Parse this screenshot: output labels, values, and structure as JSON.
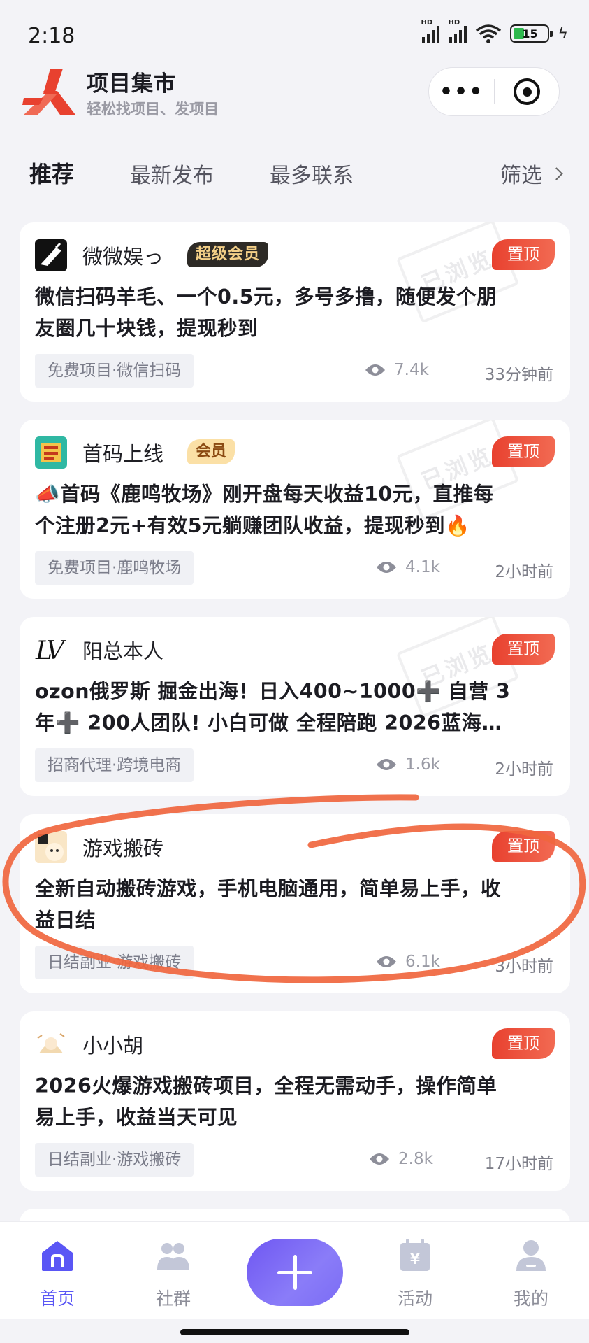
{
  "status_bar": {
    "time": "2:18",
    "signal_label_1": "HD",
    "signal_label_2": "HD",
    "battery": "15"
  },
  "header": {
    "app_title": "项目集市",
    "app_subtitle": "轻松找项目、发项目",
    "more_icon": "more-dots-icon",
    "target_icon": "target-icon",
    "brand_color": "#e8412f"
  },
  "tabs": {
    "items": [
      "推荐",
      "最新发布",
      "最多联系"
    ],
    "active": "推荐",
    "filter_label": "筛选"
  },
  "posts": [
    {
      "user": "微微娱っ",
      "badge": "超级会员",
      "pinned": "置顶",
      "title_lines": [
        "微信扫码羊毛、一个0.5元，多号多撸，随便发个朋",
        "友圈几十块钱，提现秒到"
      ],
      "tag": "免费项目·微信扫码",
      "views": "7.4k",
      "time": "33分钟前",
      "stamp": "已浏览"
    },
    {
      "user": "首码上线",
      "badge": "会员",
      "pinned": "置顶",
      "title_lines": [
        "📣首码《鹿鸣牧场》刚开盘每天收益10元，直推每",
        "个注册2元+有效5元躺赚团队收益，提现秒到🔥"
      ],
      "tag": "免费项目·鹿鸣牧场",
      "views": "4.1k",
      "time": "2小时前",
      "stamp": "已浏览"
    },
    {
      "user": "阳总本人",
      "badge": "",
      "pinned": "置顶",
      "title_lines": [
        "ozon俄罗斯 掘金出海！日入400~1000➕ 自营 3",
        "年➕ 200人团队! 小白可做 全程陪跑 2026蓝海…"
      ],
      "tag": "招商代理·跨境电商",
      "views": "1.6k",
      "time": "2小时前",
      "stamp": "已浏览"
    },
    {
      "user": "游戏搬砖",
      "badge": "",
      "pinned": "置顶",
      "title_lines": [
        "全新自动搬砖游戏，手机电脑通用，简单易上手，收",
        "益日结"
      ],
      "tag": "日结副业·游戏搬砖",
      "views": "6.1k",
      "time": "3小时前",
      "stamp": ""
    },
    {
      "user": "小小胡",
      "badge": "",
      "pinned": "置顶",
      "title_lines": [
        "2026火爆游戏搬砖项目，全程无需动手，操作简单",
        "易上手，收益当天可见"
      ],
      "tag": "日结副业·游戏搬砖",
      "views": "2.8k",
      "time": "17小时前",
      "stamp": ""
    }
  ],
  "tabbar": {
    "home": "首页",
    "community": "社群",
    "activity": "活动",
    "mine": "我的",
    "activity_icon_glyph": "¥",
    "accent": "#5a56f5"
  }
}
